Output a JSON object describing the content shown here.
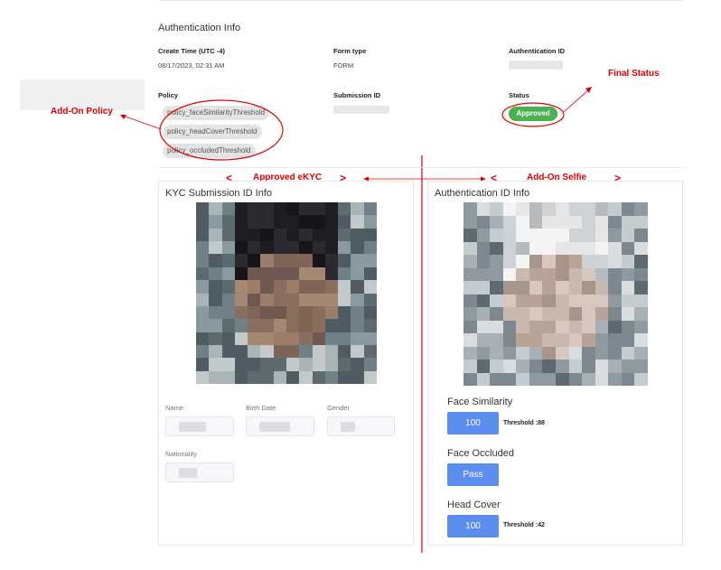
{
  "auth_info": {
    "title": "Authentication Info",
    "create_time_label": "Create Time (UTC -4)",
    "create_time_value": "08/17/2023, 02:31 AM",
    "form_type_label": "Form type",
    "form_type_value": "FORM",
    "auth_id_label": "Authentication ID",
    "policy_label": "Policy",
    "policies": [
      "policy_faceSimilarityThreshold",
      "policy_headCoverThreshold",
      "policy_occludedThreshold"
    ],
    "submission_id_label": "Submission ID",
    "status_label": "Status",
    "status_value": "Approved"
  },
  "annotations": {
    "add_on_policy": "Add-On Policy",
    "final_status": "Final Status",
    "approved_ekyc": "Approved eKYC",
    "add_on_selfie": "Add-On Selfie",
    "left_chevron": "<",
    "right_chevron": ">",
    "annotation_color": "#e00000"
  },
  "kyc_panel": {
    "title": "KYC Submission ID Info",
    "fields": {
      "name_label": "Name",
      "birth_date_label": "Birth Date",
      "gender_label": "Gender",
      "nationality_label": "Nationality"
    }
  },
  "auth_panel": {
    "title": "Authentication ID Info",
    "metrics": [
      {
        "title": "Face Similarity",
        "value": "100",
        "threshold": "Threshold :88"
      },
      {
        "title": "Face Occluded",
        "value": "Pass",
        "threshold": ""
      },
      {
        "title": "Head Cover",
        "value": "100",
        "threshold": "Threshold :42"
      }
    ]
  },
  "colors": {
    "approved_badge": "#4caf50",
    "metric_button": "#5b8def"
  }
}
